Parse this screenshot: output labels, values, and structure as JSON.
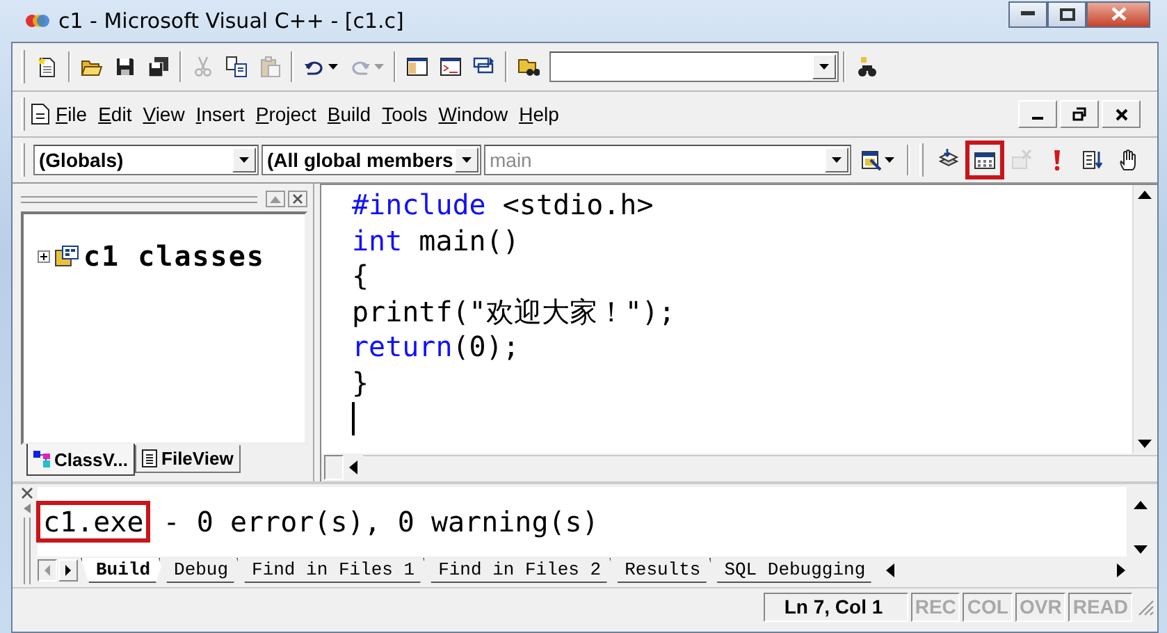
{
  "window": {
    "title": "c1 - Microsoft Visual C++ - [c1.c]"
  },
  "standard_toolbar": {
    "groups": [
      {
        "items": [
          {
            "kind": "new",
            "disabled": false
          }
        ]
      },
      {
        "items": [
          {
            "kind": "open",
            "disabled": false
          },
          {
            "kind": "save",
            "disabled": false
          },
          {
            "kind": "save_all",
            "disabled": false
          }
        ]
      },
      {
        "items": [
          {
            "kind": "cut",
            "disabled": true
          },
          {
            "kind": "copy",
            "disabled": false
          },
          {
            "kind": "paste",
            "disabled": true
          }
        ]
      },
      {
        "items": [
          {
            "kind": "undo",
            "disabled": false
          },
          {
            "kind": "redo",
            "disabled": true
          }
        ]
      },
      {
        "items": [
          {
            "kind": "workspace",
            "disabled": false
          },
          {
            "kind": "output",
            "disabled": false
          },
          {
            "kind": "windows",
            "disabled": false
          }
        ]
      },
      {
        "items": [
          {
            "kind": "find_in_files",
            "disabled": false
          },
          {
            "kind": "combo"
          }
        ]
      },
      {
        "items": [
          {
            "kind": "search_help",
            "disabled": false
          }
        ]
      }
    ]
  },
  "menu": [
    "File",
    "Edit",
    "View",
    "Insert",
    "Project",
    "Build",
    "Tools",
    "Window",
    "Help"
  ],
  "wizard_bar": {
    "class_combo": {
      "value": "(Globals)",
      "disabled": false
    },
    "members_combo": {
      "value": "(All global members",
      "disabled": false
    },
    "function_combo": {
      "value": "main",
      "disabled": true
    }
  },
  "build_toolbar": [
    {
      "kind": "compile",
      "disabled": false,
      "highlighted": false
    },
    {
      "kind": "build",
      "disabled": false,
      "highlighted": true
    },
    {
      "kind": "stop",
      "disabled": true,
      "highlighted": false
    },
    {
      "kind": "execute",
      "disabled": false,
      "highlighted": false
    },
    {
      "kind": "go",
      "disabled": false,
      "highlighted": false
    },
    {
      "kind": "breakpoint",
      "disabled": false,
      "highlighted": false
    }
  ],
  "workspace": {
    "tree": [
      {
        "label": "c1 classes",
        "expanded": false
      }
    ],
    "tabs": [
      {
        "label": "ClassV...",
        "selected": true
      },
      {
        "label": "FileView",
        "selected": false
      }
    ]
  },
  "editor": {
    "lines": [
      {
        "cursor": false,
        "tokens": [
          {
            "kind": "keyword",
            "text": "#include"
          },
          {
            "kind": "plain",
            "text": " <stdio.h>"
          }
        ]
      },
      {
        "cursor": false,
        "tokens": [
          {
            "kind": "keyword",
            "text": "int"
          },
          {
            "kind": "plain",
            "text": " main()"
          }
        ]
      },
      {
        "cursor": false,
        "tokens": [
          {
            "kind": "plain",
            "text": "{"
          }
        ]
      },
      {
        "cursor": false,
        "tokens": [
          {
            "kind": "plain",
            "text": "printf(\"欢迎大家！\");"
          }
        ]
      },
      {
        "cursor": false,
        "tokens": [
          {
            "kind": "keyword",
            "text": "return"
          },
          {
            "kind": "plain",
            "text": "(0);"
          }
        ]
      },
      {
        "cursor": false,
        "tokens": [
          {
            "kind": "plain",
            "text": "}"
          }
        ]
      },
      {
        "cursor": true
      }
    ]
  },
  "output": {
    "segments": [
      {
        "text": "c1.exe",
        "highlighted": true
      },
      {
        "text": " - 0 error(s), 0 warning(s)",
        "highlighted": false
      }
    ],
    "tabs": [
      {
        "label": "Build",
        "selected": true
      },
      {
        "label": "Debug",
        "selected": false
      },
      {
        "label": "Find in Files 1",
        "selected": false
      },
      {
        "label": "Find in Files 2",
        "selected": false
      },
      {
        "label": "Results",
        "selected": false
      },
      {
        "label": "SQL Debugging",
        "selected": false
      }
    ]
  },
  "status_bar": {
    "position": "Ln 7, Col 1",
    "indicators": [
      {
        "label": "REC",
        "enabled": false
      },
      {
        "label": "COL",
        "enabled": false
      },
      {
        "label": "OVR",
        "enabled": false
      },
      {
        "label": "READ",
        "enabled": false
      }
    ]
  }
}
